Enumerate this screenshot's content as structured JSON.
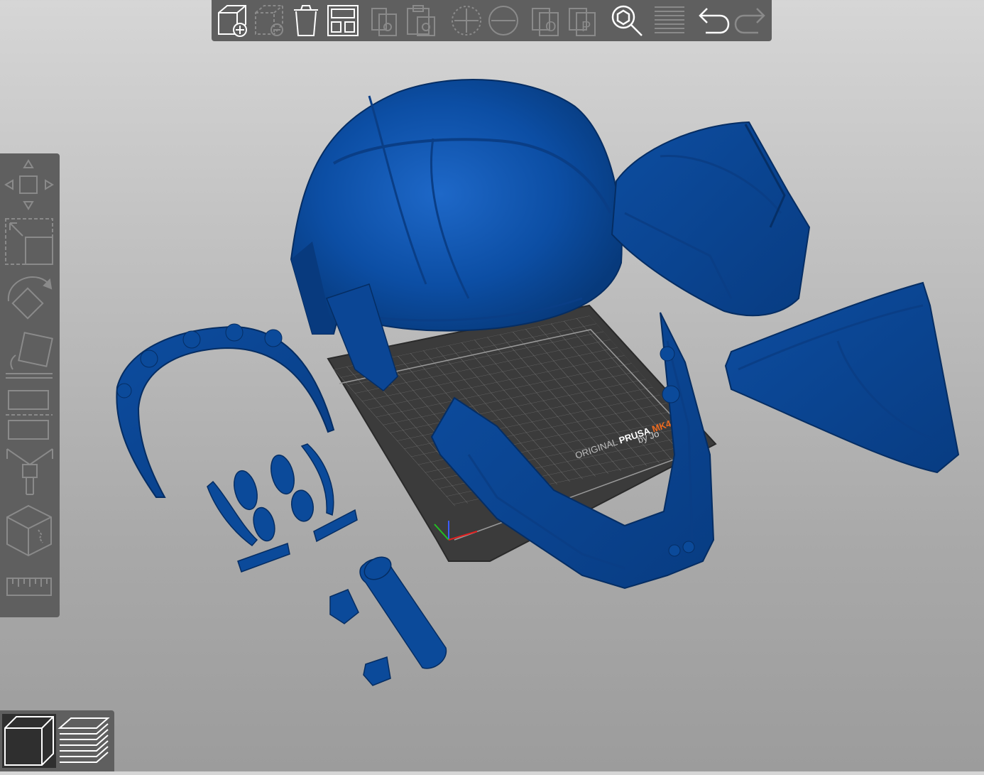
{
  "toolbar_top": {
    "buttons": [
      {
        "name": "add-button",
        "icon": "cube-plus-icon",
        "enabled": true
      },
      {
        "name": "delete-button",
        "icon": "cube-minus-icon",
        "enabled": false
      },
      {
        "name": "delete-all-button",
        "icon": "trash-icon",
        "enabled": true
      },
      {
        "name": "arrange-button",
        "icon": "arrange-icon",
        "enabled": true
      },
      {
        "name": "copy-button",
        "icon": "copy-icon",
        "enabled": false
      },
      {
        "name": "paste-button",
        "icon": "paste-icon",
        "enabled": false
      },
      {
        "name": "add-instance-button",
        "icon": "plus-circle-icon",
        "enabled": false
      },
      {
        "name": "remove-instance-button",
        "icon": "minus-circle-icon",
        "enabled": false
      },
      {
        "name": "split-objects-button",
        "icon": "split-objects-icon",
        "enabled": false
      },
      {
        "name": "split-parts-button",
        "icon": "split-parts-icon",
        "enabled": false
      },
      {
        "name": "search-button",
        "icon": "search-icon",
        "enabled": true
      },
      {
        "name": "layers-editing-button",
        "icon": "layers-icon",
        "enabled": false
      },
      {
        "name": "undo-button",
        "icon": "undo-icon",
        "enabled": true
      },
      {
        "name": "redo-button",
        "icon": "redo-icon",
        "enabled": false
      }
    ]
  },
  "toolbar_left": {
    "tools": [
      {
        "name": "move-tool",
        "icon": "move-arrows-icon"
      },
      {
        "name": "scale-tool",
        "icon": "scale-icon"
      },
      {
        "name": "rotate-tool",
        "icon": "rotate-icon"
      },
      {
        "name": "place-on-face-tool",
        "icon": "place-on-face-icon"
      },
      {
        "name": "cut-tool",
        "icon": "cut-icon"
      },
      {
        "name": "paint-supports-tool",
        "icon": "paint-brush-icon"
      },
      {
        "name": "seam-painting-tool",
        "icon": "cube-seam-icon"
      },
      {
        "name": "measure-tool",
        "icon": "ruler-icon"
      }
    ]
  },
  "view_switch": {
    "buttons": [
      {
        "name": "3d-view-button",
        "icon": "cube-icon",
        "active": true
      },
      {
        "name": "preview-button",
        "icon": "layers-stack-icon",
        "active": false
      }
    ]
  },
  "bed": {
    "logo_line1a": "ORIGINAL",
    "logo_line1b": "PRUSA",
    "logo_line1c": "MK4",
    "logo_line2": "by Jo"
  },
  "colors": {
    "model": "#0b4a9a",
    "model_dark": "#06336f",
    "model_light": "#1f66c4",
    "toolbar": "#5f5f5f",
    "bed": "#3a3a3a",
    "bed_grid": "#8a8a8a",
    "accent": "#ed6b21"
  }
}
